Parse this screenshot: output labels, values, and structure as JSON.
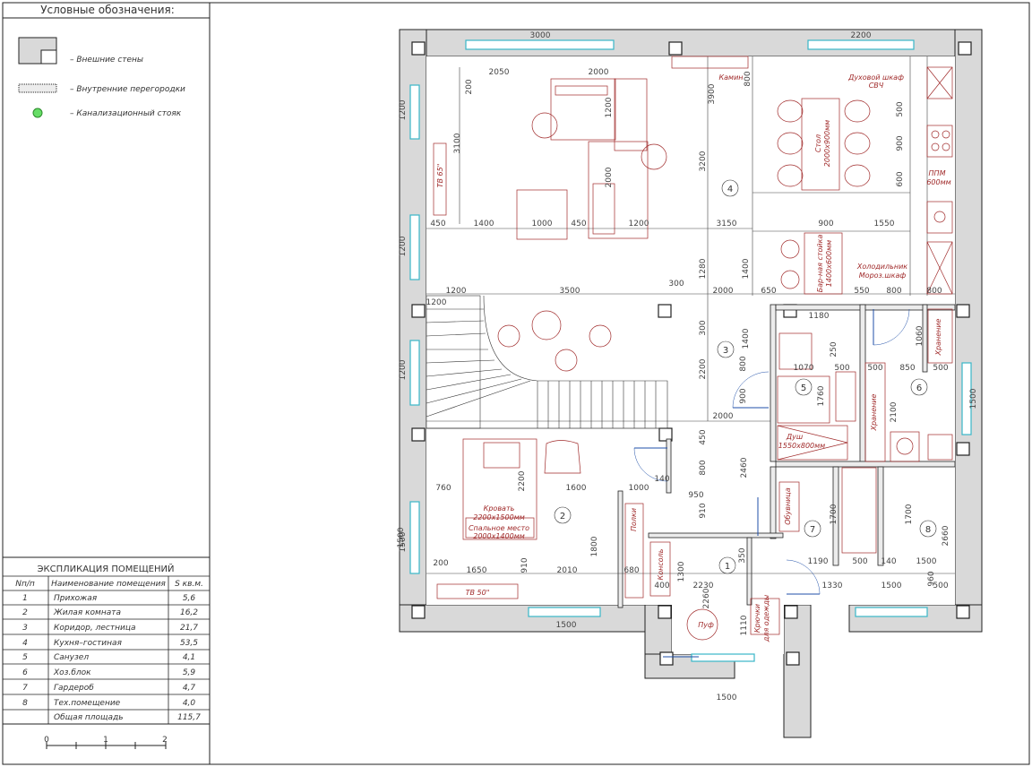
{
  "legend": {
    "title": "Условные обозначения:",
    "items": [
      {
        "label": "– Внешние стены"
      },
      {
        "label": "– Внутренние перегородки"
      },
      {
        "label": "– Канализационный стояк"
      }
    ]
  },
  "explication": {
    "title": "ЭКСПЛИКАЦИЯ ПОМЕЩЕНИЙ",
    "headers": [
      "Nп/п",
      "Наименование помещения",
      "S кв.м."
    ],
    "rows": [
      [
        "1",
        "Прихожая",
        "5,6"
      ],
      [
        "2",
        "Жилая комната",
        "16,2"
      ],
      [
        "3",
        "Коридор, лестница",
        "21,7"
      ],
      [
        "4",
        "Кухня–гостиная",
        "53,5"
      ],
      [
        "5",
        "Санузел",
        "4,1"
      ],
      [
        "6",
        "Хоз.блок",
        "5,9"
      ],
      [
        "7",
        "Гардероб",
        "4,7"
      ],
      [
        "8",
        "Тех.помещение",
        "4,0"
      ],
      [
        "",
        "Общая площадь",
        "115,7"
      ]
    ]
  },
  "scale_bar": [
    "0",
    "1",
    "2"
  ],
  "colors": {
    "wall_fill": "#d9d9d9",
    "line": "#222222",
    "furniture": "#a02a2a",
    "window": "#39b6c8",
    "riser": "#66dd66"
  },
  "rooms": {
    "labels": [
      "1",
      "2",
      "3",
      "4",
      "5",
      "6",
      "7",
      "8"
    ],
    "furniture": {
      "tv65": "ТВ 65\"",
      "tv50": "ТВ 50\"",
      "fireplace": "Камин",
      "oven": "Духовой шкаф",
      "microwave": "СВЧ",
      "table": "Стол",
      "table_size": "2000х900мм",
      "dishwasher": "ППМ",
      "dishwasher_size": "600мм",
      "fridge": "Холодильник",
      "freezer": "Мороз.шкаф",
      "bar": "Бар-ная стойка",
      "bar_size": "1400х600мм",
      "bed": "Кровать",
      "bed_size": "2200х1500мм",
      "sleep": "Спальное место",
      "sleep_size": "2000х1400мм",
      "shower": "Душ",
      "shower_size": "1550х800мм",
      "storage": "Хранение",
      "storage2": "Хранение",
      "shoes": "Обувница",
      "hooks1": "Крючки",
      "hooks2": "для одежды",
      "pouf": "Пуф",
      "console": "Консоль",
      "shelves": "Полки"
    }
  },
  "dimensions": {
    "d3000": "3000",
    "d2200a": "2200",
    "d2050": "2050",
    "d2000a": "2000",
    "d3900": "3900",
    "d800a": "800",
    "d200a": "200",
    "d500a": "500",
    "d900a": "900",
    "d600a": "600",
    "d1200a": "1200",
    "d3100": "3100",
    "d1200b": "1200",
    "d2000b": "2000",
    "d3200": "3200",
    "d450a": "450",
    "d1400a": "1400",
    "d1000a": "1000",
    "d450b": "450",
    "d1200c": "1200",
    "d3150": "3150",
    "d900b": "900",
    "d1550": "1550",
    "d1400b": "1400",
    "d1280": "1280",
    "d1200d": "1200",
    "d3500": "3500",
    "d300a": "300",
    "d2000c": "2000",
    "d650": "650",
    "d550": "550",
    "d800b": "800",
    "d800c": "800",
    "d1180": "1180",
    "d1060": "1060",
    "d1200e": "1200",
    "d2200b": "2200",
    "d1400c": "1400",
    "d1070": "1070",
    "d500b": "500",
    "d500c": "500",
    "d850": "850",
    "d500d": "500",
    "d1760": "1760",
    "d2100": "2100",
    "d1500a": "1500",
    "d900c": "900",
    "d800d": "800",
    "d2000d": "2000",
    "d450c": "450",
    "d760": "760",
    "d2200c": "2200",
    "d1600": "1600",
    "d1000b": "1000",
    "d140a": "140",
    "d950": "950",
    "d800e": "800",
    "d910": "910",
    "d2460": "2460",
    "d1700a": "1700",
    "d1700b": "1700",
    "d2660": "2660",
    "d1500b": "1500",
    "d200b": "200",
    "d1650": "1650",
    "d910b": "910",
    "d2010": "2010",
    "d680": "680",
    "d1190": "1190",
    "d500e": "500",
    "d140b": "140",
    "d1500c": "1500",
    "d1330": "1330",
    "d1500d": "1500",
    "d960": "960",
    "d500f": "500",
    "d400": "400",
    "d2230": "2230",
    "d1300": "1300",
    "d2260": "2260",
    "d350": "350",
    "d1110": "1110",
    "d1500e": "1500",
    "d1500f": "1500",
    "d1800": "1800",
    "d300b": "300",
    "d250": "250",
    "d1200f": "1200",
    "d1200g": "1200",
    "d1500g": "1500"
  }
}
